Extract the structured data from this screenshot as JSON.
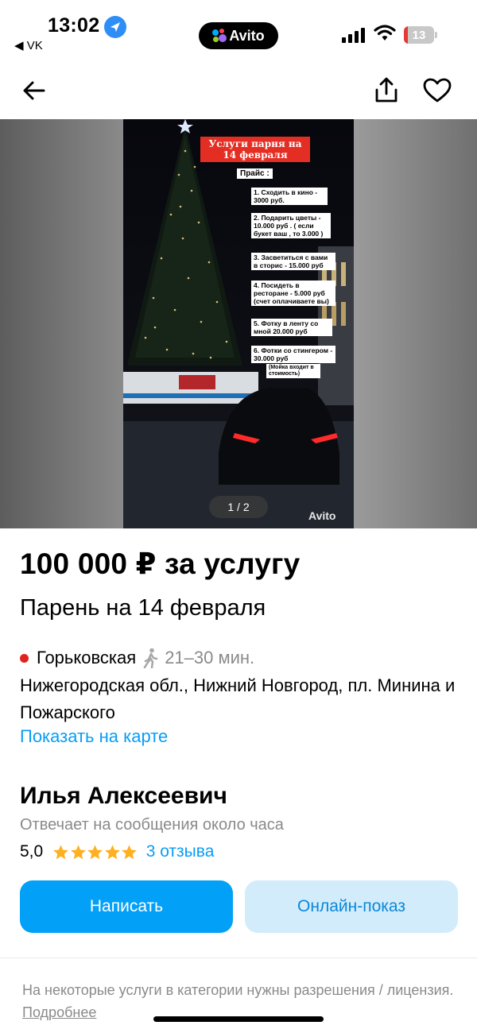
{
  "status_bar": {
    "time": "13:02",
    "back_app": "◀ VK",
    "app_pill": "Avito",
    "battery_level": "13",
    "battery_fraction": 0.13
  },
  "nav": {
    "back_icon": "arrow-left-icon",
    "share_icon": "share-icon",
    "favorite_icon": "heart-icon"
  },
  "gallery": {
    "counter": "1 / 2",
    "watermark": "Avito",
    "banner": "Услуги парня на 14 февраля",
    "price_heading": "Прайс :",
    "price_list": [
      "1. Сходить в кино - 3000 руб.",
      "2. Подарить цветы - 10.000 руб . ( если букет ваш , то 3.000 )",
      "3. Засветиться с вами в сторис - 15.000 руб",
      "4. Посидеть в ресторане - 5.000 руб (счет оплачиваете вы)",
      "5. Фотку в ленту со мной 20.000 руб",
      "6. Фотки со стингером - 30.000 руб",
      "(Мойка входит в стоимость)"
    ]
  },
  "listing": {
    "price": "100 000 ₽ за услугу",
    "title": "Парень на 14 февраля",
    "metro_station": "Горьковская",
    "metro_color": "#e1231f",
    "walk_time": "21–30 мин.",
    "address": "Нижегородская обл., Нижний Новгород, пл. Минина и Пожарского",
    "map_link": "Показать на карте"
  },
  "seller": {
    "name": "Илья Алексеевич",
    "reply_time": "Отвечает на сообщения около часа",
    "rating": "5,0",
    "stars": 5,
    "reviews": "3 отзыва"
  },
  "actions": {
    "write": "Написать",
    "online_show": "Онлайн-показ"
  },
  "disclaimer": {
    "text": "На некоторые услуги в категории нужны разрешения / лицензия.",
    "more": "Подробнее"
  },
  "colors": {
    "accent": "#02a1f7",
    "link": "#0a9df3",
    "secondary_button": "#d3ecfc",
    "star": "#ffb021"
  }
}
